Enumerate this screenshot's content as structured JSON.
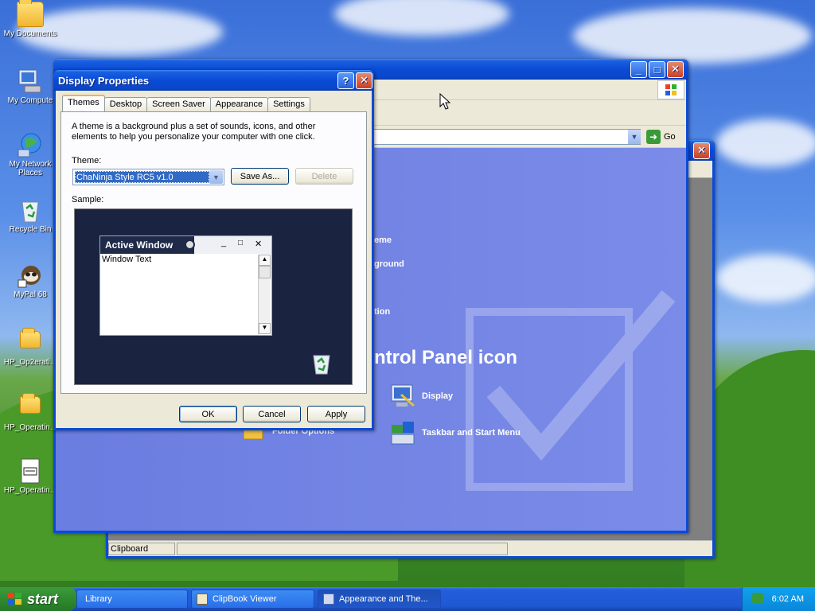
{
  "desktop": {
    "icons": [
      {
        "label": "My Documents",
        "icon": "my-documents-icon"
      },
      {
        "label": "My Compute",
        "icon": "my-computer-icon"
      },
      {
        "label": "My Network Places",
        "icon": "network-icon"
      },
      {
        "label": "Recycle Bin",
        "icon": "recycle-bin-icon"
      },
      {
        "label": "MyPal 68",
        "icon": "mypal-icon"
      },
      {
        "label": "HP_Op2erati...",
        "icon": "folder-icon"
      },
      {
        "label": "HP_Operatin...",
        "icon": "folder-icon"
      },
      {
        "label": "HP_Operatin...",
        "icon": "text-file-icon"
      }
    ]
  },
  "control_panel": {
    "go_label": "Go",
    "fragments": {
      "theme": "eme",
      "background": "ground",
      "saver": "tion",
      "heading": "ntrol Panel icon"
    },
    "items": [
      {
        "label": "Display",
        "icon": "display-icon"
      },
      {
        "label": "Folder Options",
        "icon": "folder-options-icon"
      },
      {
        "label": "Taskbar and Start Menu",
        "icon": "taskbar-icon"
      }
    ]
  },
  "clipbook": {
    "status": "Clipboard"
  },
  "dialog": {
    "title": "Display Properties",
    "tabs": [
      "Themes",
      "Desktop",
      "Screen Saver",
      "Appearance",
      "Settings"
    ],
    "description": "A theme is a background plus a set of sounds, icons, and other elements to help you personalize your computer with one click.",
    "theme_label": "Theme:",
    "theme_value": "ChaNinja Style RC5 v1.0",
    "save_as": "Save As...",
    "delete": "Delete",
    "sample_label": "Sample:",
    "preview": {
      "window_title": "Active Window",
      "window_text": "Window Text"
    },
    "ok": "OK",
    "cancel": "Cancel",
    "apply": "Apply"
  },
  "taskbar": {
    "start": "start",
    "tasks": [
      {
        "label": "Library"
      },
      {
        "label": "ClipBook Viewer"
      },
      {
        "label": "Appearance and The..."
      }
    ],
    "clock": "6:02 AM"
  }
}
